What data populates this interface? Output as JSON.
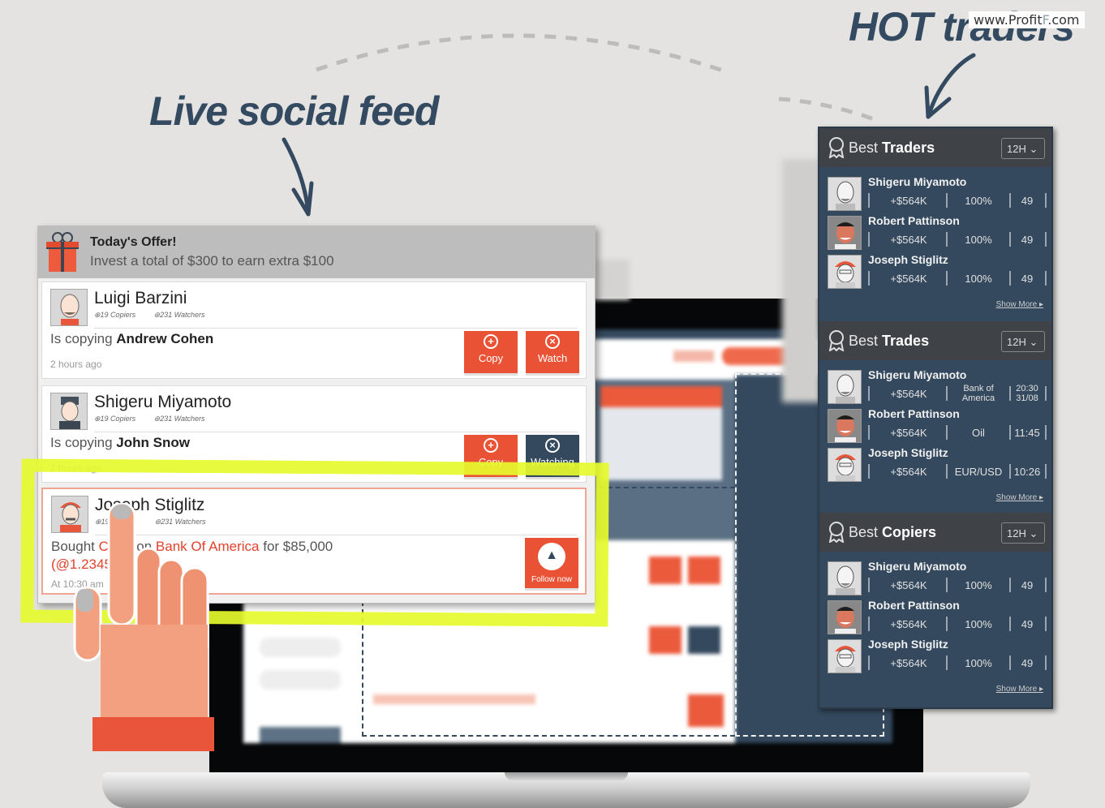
{
  "headlines": {
    "live_feed": "Live social feed",
    "hot_traders": "HOT traders"
  },
  "watermark": {
    "prefix": "www.Profit",
    "accent": "F",
    "suffix": ".com"
  },
  "colors": {
    "accent_orange": "#ea5235",
    "navy": "#34495e",
    "highlight_yellow": "#e6fa2c",
    "headline": "#344a60"
  },
  "feed": {
    "offer": {
      "icon": "gift-icon",
      "title": "Today's Offer!",
      "subtitle": "Invest a total of $300 to earn extra $100"
    },
    "posts": [
      {
        "name": "Luigi Barzini",
        "copiers": "19 Copiers",
        "watchers": "231 Watchers",
        "action_prefix": "Is copying",
        "action_target": "Andrew Cohen",
        "time": "2 hours ago",
        "buttons": [
          {
            "label": "Copy",
            "icon": "plus-circle-icon",
            "style": "orange"
          },
          {
            "label": "Watch",
            "icon": "eye-circle-icon",
            "style": "orange"
          }
        ]
      },
      {
        "name": "Shigeru Miyamoto",
        "copiers": "19 Copiers",
        "watchers": "231 Watchers",
        "action_prefix": "Is copying",
        "action_target": "John Snow",
        "time": "2 hours ago",
        "buttons": [
          {
            "label": "Copy",
            "icon": "plus-circle-icon",
            "style": "orange"
          },
          {
            "label": "Watching",
            "icon": "eye-circle-icon",
            "style": "navy"
          }
        ]
      },
      {
        "name": "Joseph Stiglitz",
        "copiers": "19 Copiers",
        "watchers": "231 Watchers",
        "action_prefix": "Bought",
        "action_asset": "CALL",
        "action_on": "on",
        "action_target": "Bank Of America",
        "action_suffix": "for $85,000",
        "action_rate": "(@1.2345)",
        "time": "At 10:30 am",
        "buttons": [
          {
            "label": "Follow now",
            "icon": "triangle-up-icon",
            "style": "orange"
          }
        ]
      }
    ]
  },
  "side_panel": {
    "sections": [
      {
        "title_light": "Best",
        "title_bold": "Traders",
        "period": "12H",
        "rows": [
          {
            "name": "Shigeru Miyamoto",
            "profit": "+$564K",
            "col2": "100%",
            "col3": "49"
          },
          {
            "name": "Robert Pattinson",
            "profit": "+$564K",
            "col2": "100%",
            "col3": "49"
          },
          {
            "name": "Joseph Stiglitz",
            "profit": "+$564K",
            "col2": "100%",
            "col3": "49"
          }
        ],
        "show_more": "Show More ▸"
      },
      {
        "title_light": "Best",
        "title_bold": "Trades",
        "period": "12H",
        "rows": [
          {
            "name": "Shigeru Miyamoto",
            "profit": "+$564K",
            "col2": "Bank of America",
            "col3": "20:30 31/08"
          },
          {
            "name": "Robert Pattinson",
            "profit": "+$564K",
            "col2": "Oil",
            "col3": "11:45"
          },
          {
            "name": "Joseph Stiglitz",
            "profit": "+$564K",
            "col2": "EUR/USD",
            "col3": "10:26"
          }
        ],
        "show_more": "Show More ▸"
      },
      {
        "title_light": "Best",
        "title_bold": "Copiers",
        "period": "12H",
        "rows": [
          {
            "name": "Shigeru Miyamoto",
            "profit": "+$564K",
            "col2": "100%",
            "col3": "49"
          },
          {
            "name": "Robert Pattinson",
            "profit": "+$564K",
            "col2": "100%",
            "col3": "49"
          },
          {
            "name": "Joseph Stiglitz",
            "profit": "+$564K",
            "col2": "100%",
            "col3": "49"
          }
        ],
        "show_more": "Show More ▸"
      }
    ]
  }
}
